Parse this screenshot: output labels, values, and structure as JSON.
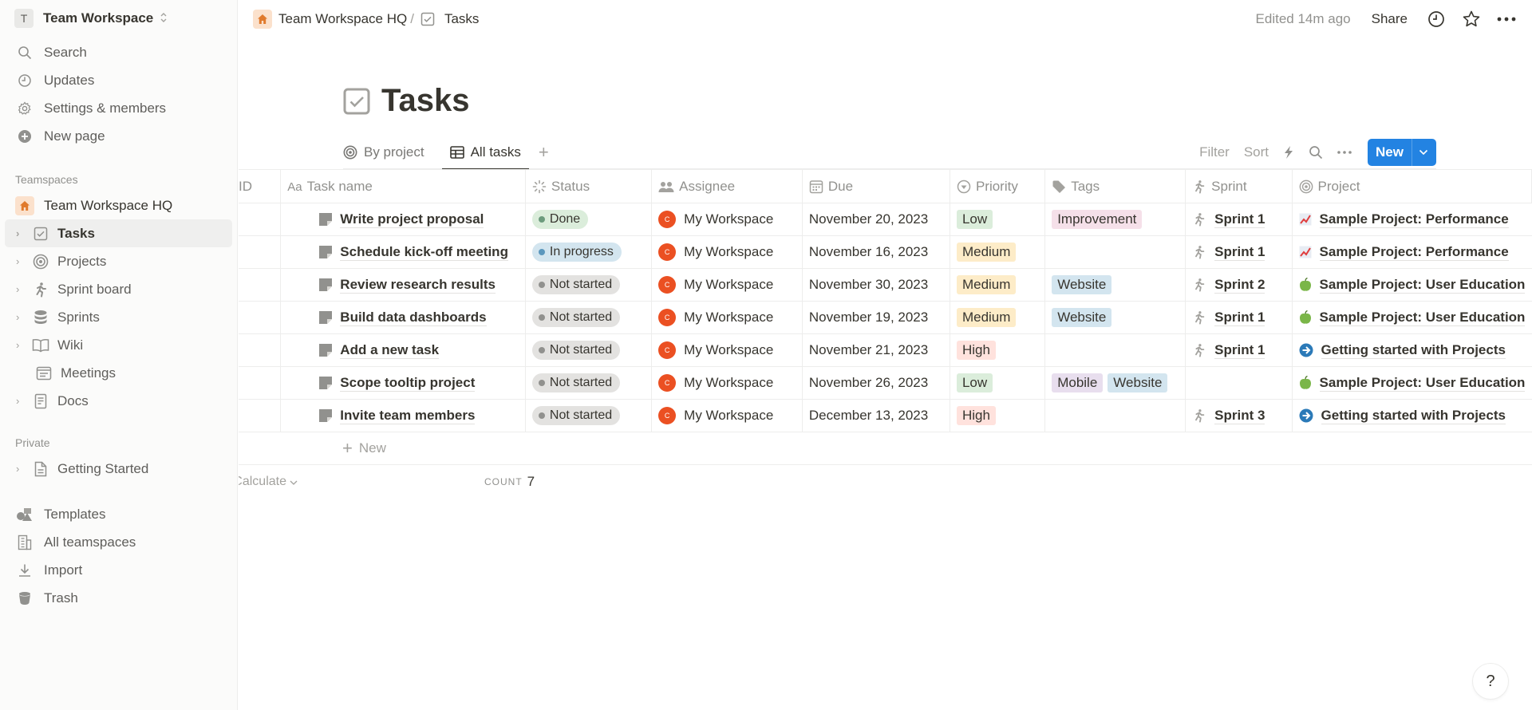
{
  "sidebar": {
    "workspace": {
      "initial": "T",
      "name": "Team Workspace"
    },
    "nav": [
      {
        "label": "Search",
        "icon": "search-icon"
      },
      {
        "label": "Updates",
        "icon": "clock-icon"
      },
      {
        "label": "Settings & members",
        "icon": "gear-icon"
      },
      {
        "label": "New page",
        "icon": "plus-circle-icon"
      }
    ],
    "teamspaces_label": "Teamspaces",
    "teamspace_root": "Team Workspace HQ",
    "teamspace_items": [
      {
        "label": "Tasks",
        "icon": "checkbox-icon",
        "active": true
      },
      {
        "label": "Projects",
        "icon": "target-icon"
      },
      {
        "label": "Sprint board",
        "icon": "runner-icon"
      },
      {
        "label": "Sprints",
        "icon": "database-icon"
      },
      {
        "label": "Wiki",
        "icon": "book-icon"
      },
      {
        "label": "Meetings",
        "icon": "calendar-list-icon"
      },
      {
        "label": "Docs",
        "icon": "document-icon"
      }
    ],
    "private_label": "Private",
    "private_items": [
      {
        "label": "Getting Started",
        "icon": "page-icon"
      }
    ],
    "bottom": [
      {
        "label": "Templates",
        "icon": "shapes-icon"
      },
      {
        "label": "All teamspaces",
        "icon": "building-icon"
      },
      {
        "label": "Import",
        "icon": "download-icon"
      },
      {
        "label": "Trash",
        "icon": "trash-icon"
      }
    ]
  },
  "topbar": {
    "breadcrumb": [
      "Team Workspace HQ",
      "Tasks"
    ],
    "separator": "/",
    "edited": "Edited 14m ago",
    "share": "Share"
  },
  "page": {
    "title": "Tasks",
    "views": [
      {
        "label": "By project",
        "icon": "target-icon",
        "active": false
      },
      {
        "label": "All tasks",
        "icon": "table-icon",
        "active": true
      }
    ],
    "actions": {
      "filter": "Filter",
      "sort": "Sort",
      "new": "New"
    }
  },
  "table": {
    "columns": [
      "ID",
      "Task name",
      "Status",
      "Assignee",
      "Due",
      "Priority",
      "Tags",
      "Sprint",
      "Project"
    ],
    "column_prefix_taskname": "Aa",
    "rows": [
      {
        "name": "Write project proposal",
        "status": "Done",
        "assignee": "My Workspace",
        "avatar": "C",
        "due": "November 20, 2023",
        "priority": "Low",
        "tags": [
          "Improvement"
        ],
        "sprint": "Sprint 1",
        "project": "Sample Project: Performance",
        "project_icon": "chart-icon"
      },
      {
        "name": "Schedule kick-off meeting",
        "status": "In progress",
        "assignee": "My Workspace",
        "avatar": "C",
        "due": "November 16, 2023",
        "priority": "Medium",
        "tags": [],
        "sprint": "Sprint 1",
        "project": "Sample Project: Performance",
        "project_icon": "chart-icon"
      },
      {
        "name": "Review research results",
        "status": "Not started",
        "assignee": "My Workspace",
        "avatar": "C",
        "due": "November 30, 2023",
        "priority": "Medium",
        "tags": [
          "Website"
        ],
        "sprint": "Sprint 2",
        "project": "Sample Project: User Education",
        "project_icon": "apple-icon"
      },
      {
        "name": "Build data dashboards",
        "status": "Not started",
        "assignee": "My Workspace",
        "avatar": "C",
        "due": "November 19, 2023",
        "priority": "Medium",
        "tags": [
          "Website"
        ],
        "sprint": "Sprint 1",
        "project": "Sample Project: User Education",
        "project_icon": "apple-icon"
      },
      {
        "name": "Add a new task",
        "status": "Not started",
        "assignee": "My Workspace",
        "avatar": "C",
        "due": "November 21, 2023",
        "priority": "High",
        "tags": [],
        "sprint": "Sprint 1",
        "project": "Getting started with Projects",
        "project_icon": "arrow-circle-icon"
      },
      {
        "name": "Scope tooltip project",
        "status": "Not started",
        "assignee": "My Workspace",
        "avatar": "C",
        "due": "November 26, 2023",
        "priority": "Low",
        "tags": [
          "Mobile",
          "Website"
        ],
        "sprint": "",
        "project": "Sample Project: User Education",
        "project_icon": "apple-icon"
      },
      {
        "name": "Invite team members",
        "status": "Not started",
        "assignee": "My Workspace",
        "avatar": "C",
        "due": "December 13, 2023",
        "priority": "High",
        "tags": [],
        "sprint": "Sprint 3",
        "project": "Getting started with Projects",
        "project_icon": "arrow-circle-icon"
      }
    ],
    "new_row": "New",
    "calculate": "Calculate",
    "count_label": "COUNT",
    "count_value": "7"
  },
  "colors": {
    "accent": "#2383e2",
    "status": {
      "Done": {
        "bg": "#dbeddb",
        "dot": "#6c9b7d"
      },
      "In progress": {
        "bg": "#d3e5ef",
        "dot": "#5b97bd"
      },
      "Not started": {
        "bg": "#e3e2e0",
        "dot": "#91918e"
      }
    },
    "priority": {
      "Low": "#dbeddb",
      "Medium": "#fdecc8",
      "High": "#ffe2dd"
    },
    "tags": {
      "Improvement": "#f5e0e9",
      "Website": "#d3e5ef",
      "Mobile": "#e8deee"
    }
  },
  "help": "?"
}
